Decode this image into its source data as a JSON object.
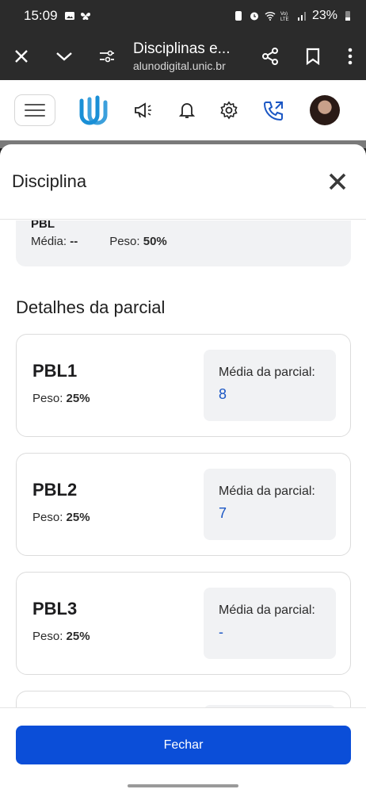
{
  "status": {
    "time": "15:09",
    "battery": "23%",
    "icons": [
      "image-icon",
      "butterfly-icon",
      "battery-saver-icon",
      "alarm-icon",
      "wifi-icon",
      "volte-icon",
      "signal-icon",
      "battery-icon"
    ]
  },
  "browser": {
    "title": "Disciplinas e...",
    "url": "alunodigital.unic.br",
    "icons": [
      "close-icon",
      "chevron-down-icon",
      "tune-icon",
      "share-icon",
      "bookmark-icon",
      "more-vert-icon"
    ]
  },
  "header": {
    "icons": [
      "menu-icon",
      "logo-icon",
      "megaphone-icon",
      "bell-icon",
      "gear-icon",
      "phone-support-icon",
      "avatar"
    ]
  },
  "modal": {
    "title": "Disciplina",
    "summary": {
      "name": "PBL",
      "media_label": "Média:",
      "media_value": "--",
      "peso_label": "Peso:",
      "peso_value": "50%"
    },
    "section_title": "Detalhes da parcial",
    "items": [
      {
        "title": "PBL1",
        "peso_label": "Peso:",
        "peso_value": "25%",
        "media_label": "Média da parcial:",
        "media_value": "8"
      },
      {
        "title": "PBL2",
        "peso_label": "Peso:",
        "peso_value": "25%",
        "media_label": "Média da parcial:",
        "media_value": "7"
      },
      {
        "title": "PBL3",
        "peso_label": "Peso:",
        "peso_value": "25%",
        "media_label": "Média da parcial:",
        "media_value": "-"
      }
    ],
    "close_button": "Fechar"
  },
  "colors": {
    "primary": "#0b4ed8",
    "value_blue": "#1a56c4",
    "brand": "#1a8fd6"
  }
}
